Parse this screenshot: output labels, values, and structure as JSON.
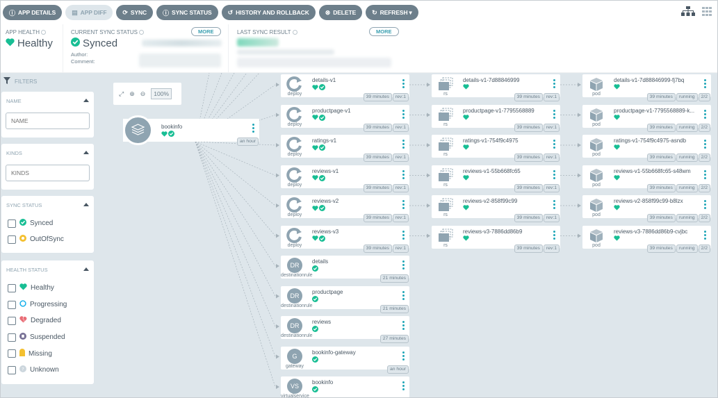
{
  "toolbar": {
    "buttons": [
      {
        "label": "APP DETAILS",
        "icon": "info-icon",
        "disabled": false
      },
      {
        "label": "APP DIFF",
        "icon": "file-icon",
        "disabled": true
      },
      {
        "label": "SYNC",
        "icon": "sync-icon",
        "disabled": false
      },
      {
        "label": "SYNC STATUS",
        "icon": "info-icon",
        "disabled": false
      },
      {
        "label": "HISTORY AND ROLLBACK",
        "icon": "history-icon",
        "disabled": false
      },
      {
        "label": "DELETE",
        "icon": "delete-icon",
        "disabled": false
      },
      {
        "label": "REFRESH",
        "icon": "refresh-icon",
        "disabled": false
      }
    ],
    "view_icons": [
      "tree-view-icon",
      "grid-view-icon"
    ]
  },
  "status": {
    "app_health": {
      "label": "APP HEALTH",
      "value": "Healthy"
    },
    "current_sync": {
      "label": "CURRENT SYNC STATUS",
      "value": "Synced",
      "more": "MORE",
      "author_label": "Author:",
      "comment_label": "Comment:"
    },
    "last_sync": {
      "label": "LAST SYNC RESULT",
      "more": "MORE"
    }
  },
  "filters": {
    "title": "FILTERS",
    "name": {
      "label": "NAME",
      "placeholder": "NAME"
    },
    "kinds": {
      "label": "KINDS",
      "placeholder": "KINDS"
    },
    "sync_status": {
      "label": "SYNC STATUS",
      "options": [
        "Synced",
        "OutOfSync"
      ]
    },
    "health_status": {
      "label": "HEALTH STATUS",
      "options": [
        "Healthy",
        "Progressing",
        "Degraded",
        "Suspended",
        "Missing",
        "Unknown"
      ]
    }
  },
  "colors": {
    "healthy": "#18be94",
    "progressing": "#0dadea",
    "degraded": "#e96d76",
    "suspended": "#766f94",
    "missing": "#f4c030",
    "unknown": "#ccd6dd",
    "accent": "#1fa6b7"
  },
  "graph": {
    "zoom_level": "100%",
    "root": {
      "name": "bookinfo",
      "age": "an hour"
    },
    "deployments": [
      {
        "name": "details-v1",
        "kind": "deploy",
        "age": "39 minutes",
        "rev": "rev:1"
      },
      {
        "name": "productpage-v1",
        "kind": "deploy",
        "age": "39 minutes",
        "rev": "rev:1"
      },
      {
        "name": "ratings-v1",
        "kind": "deploy",
        "age": "39 minutes",
        "rev": "rev:1"
      },
      {
        "name": "reviews-v1",
        "kind": "deploy",
        "age": "39 minutes",
        "rev": "rev:1"
      },
      {
        "name": "reviews-v2",
        "kind": "deploy",
        "age": "39 minutes",
        "rev": "rev:1"
      },
      {
        "name": "reviews-v3",
        "kind": "deploy",
        "age": "39 minutes",
        "rev": "rev:1"
      }
    ],
    "others": [
      {
        "name": "details",
        "kind": "destinationrule",
        "abbr": "DR",
        "age": "21 minutes"
      },
      {
        "name": "productpage",
        "kind": "destinationrule",
        "abbr": "DR",
        "age": "21 minutes"
      },
      {
        "name": "reviews",
        "kind": "destinationrule",
        "abbr": "DR",
        "age": "27 minutes"
      },
      {
        "name": "bookinfo-gateway",
        "kind": "gateway",
        "abbr": "G",
        "age": "an hour"
      },
      {
        "name": "bookinfo",
        "kind": "virtualservice",
        "abbr": "VS",
        "age": ""
      }
    ],
    "replicasets": [
      {
        "name": "details-v1-7d88846999",
        "kind": "rs",
        "age": "39 minutes",
        "rev": "rev:1"
      },
      {
        "name": "productpage-v1-7795568889",
        "kind": "rs",
        "age": "39 minutes",
        "rev": "rev:1"
      },
      {
        "name": "ratings-v1-754f9c4975",
        "kind": "rs",
        "age": "39 minutes",
        "rev": "rev:1"
      },
      {
        "name": "reviews-v1-55b668fc65",
        "kind": "rs",
        "age": "39 minutes",
        "rev": "rev:1"
      },
      {
        "name": "reviews-v2-858f99c99",
        "kind": "rs",
        "age": "39 minutes",
        "rev": "rev:1"
      },
      {
        "name": "reviews-v3-7886dd86b9",
        "kind": "rs",
        "age": "39 minutes",
        "rev": "rev:1"
      }
    ],
    "pods": [
      {
        "name": "details-v1-7d88846999-fj7bq",
        "kind": "pod",
        "age": "39 minutes",
        "state": "running",
        "ready": "2/2"
      },
      {
        "name": "productpage-v1-7795568889-k...",
        "kind": "pod",
        "age": "39 minutes",
        "state": "running",
        "ready": "2/2"
      },
      {
        "name": "ratings-v1-754f9c4975-asndb",
        "kind": "pod",
        "age": "39 minutes",
        "state": "running",
        "ready": "2/2"
      },
      {
        "name": "reviews-v1-55b668fc65-s48wm",
        "kind": "pod",
        "age": "39 minutes",
        "state": "running",
        "ready": "2/2"
      },
      {
        "name": "reviews-v2-858f99c99-b8lzx",
        "kind": "pod",
        "age": "39 minutes",
        "state": "running",
        "ready": "2/2"
      },
      {
        "name": "reviews-v3-7886dd86b9-cvjbc",
        "kind": "pod",
        "age": "39 minutes",
        "state": "running",
        "ready": "2/2"
      }
    ]
  }
}
